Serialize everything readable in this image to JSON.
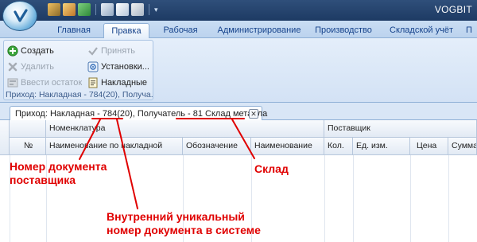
{
  "window": {
    "title": "VOGBIT"
  },
  "ribbon_tabs": [
    "Главная",
    "Правка",
    "Рабочая",
    "Администрирование",
    "Производство",
    "Складской учёт",
    "П"
  ],
  "ribbon_group": {
    "buttons": {
      "create": "Создать",
      "delete": "Удалить",
      "enter_balance": "Ввести остаток",
      "accept": "Принять",
      "settings": "Установки...",
      "invoices": "Накладные"
    },
    "caption": "Приход: Накладная - 784(20), Получа..."
  },
  "document_tab": {
    "prefix": "Приход: Накладная - ",
    "doc_number": "784",
    "internal_id": "(20)",
    "middle": ", Получатель - ",
    "warehouse": "81 Склад металла",
    "close_glyph": "✕"
  },
  "grid": {
    "group_headers": {
      "nomenclature": "Номенклатура",
      "supplier": "Поставщик"
    },
    "columns": [
      "№",
      "Наименование по накладной",
      "Обозначение",
      "Наименование",
      "Кол.",
      "Ед. изм.",
      "Цена",
      "Сумма"
    ]
  },
  "annotations": {
    "supplier_number": [
      "Номер документа",
      "поставщика"
    ],
    "warehouse": "Склад",
    "internal_number": [
      "Внутренний уникальный",
      "номер документа в системе"
    ]
  },
  "colors": {
    "annotation": "#e00000",
    "ribbon_text": "#15428b",
    "titlebar": "#1d3a63"
  }
}
